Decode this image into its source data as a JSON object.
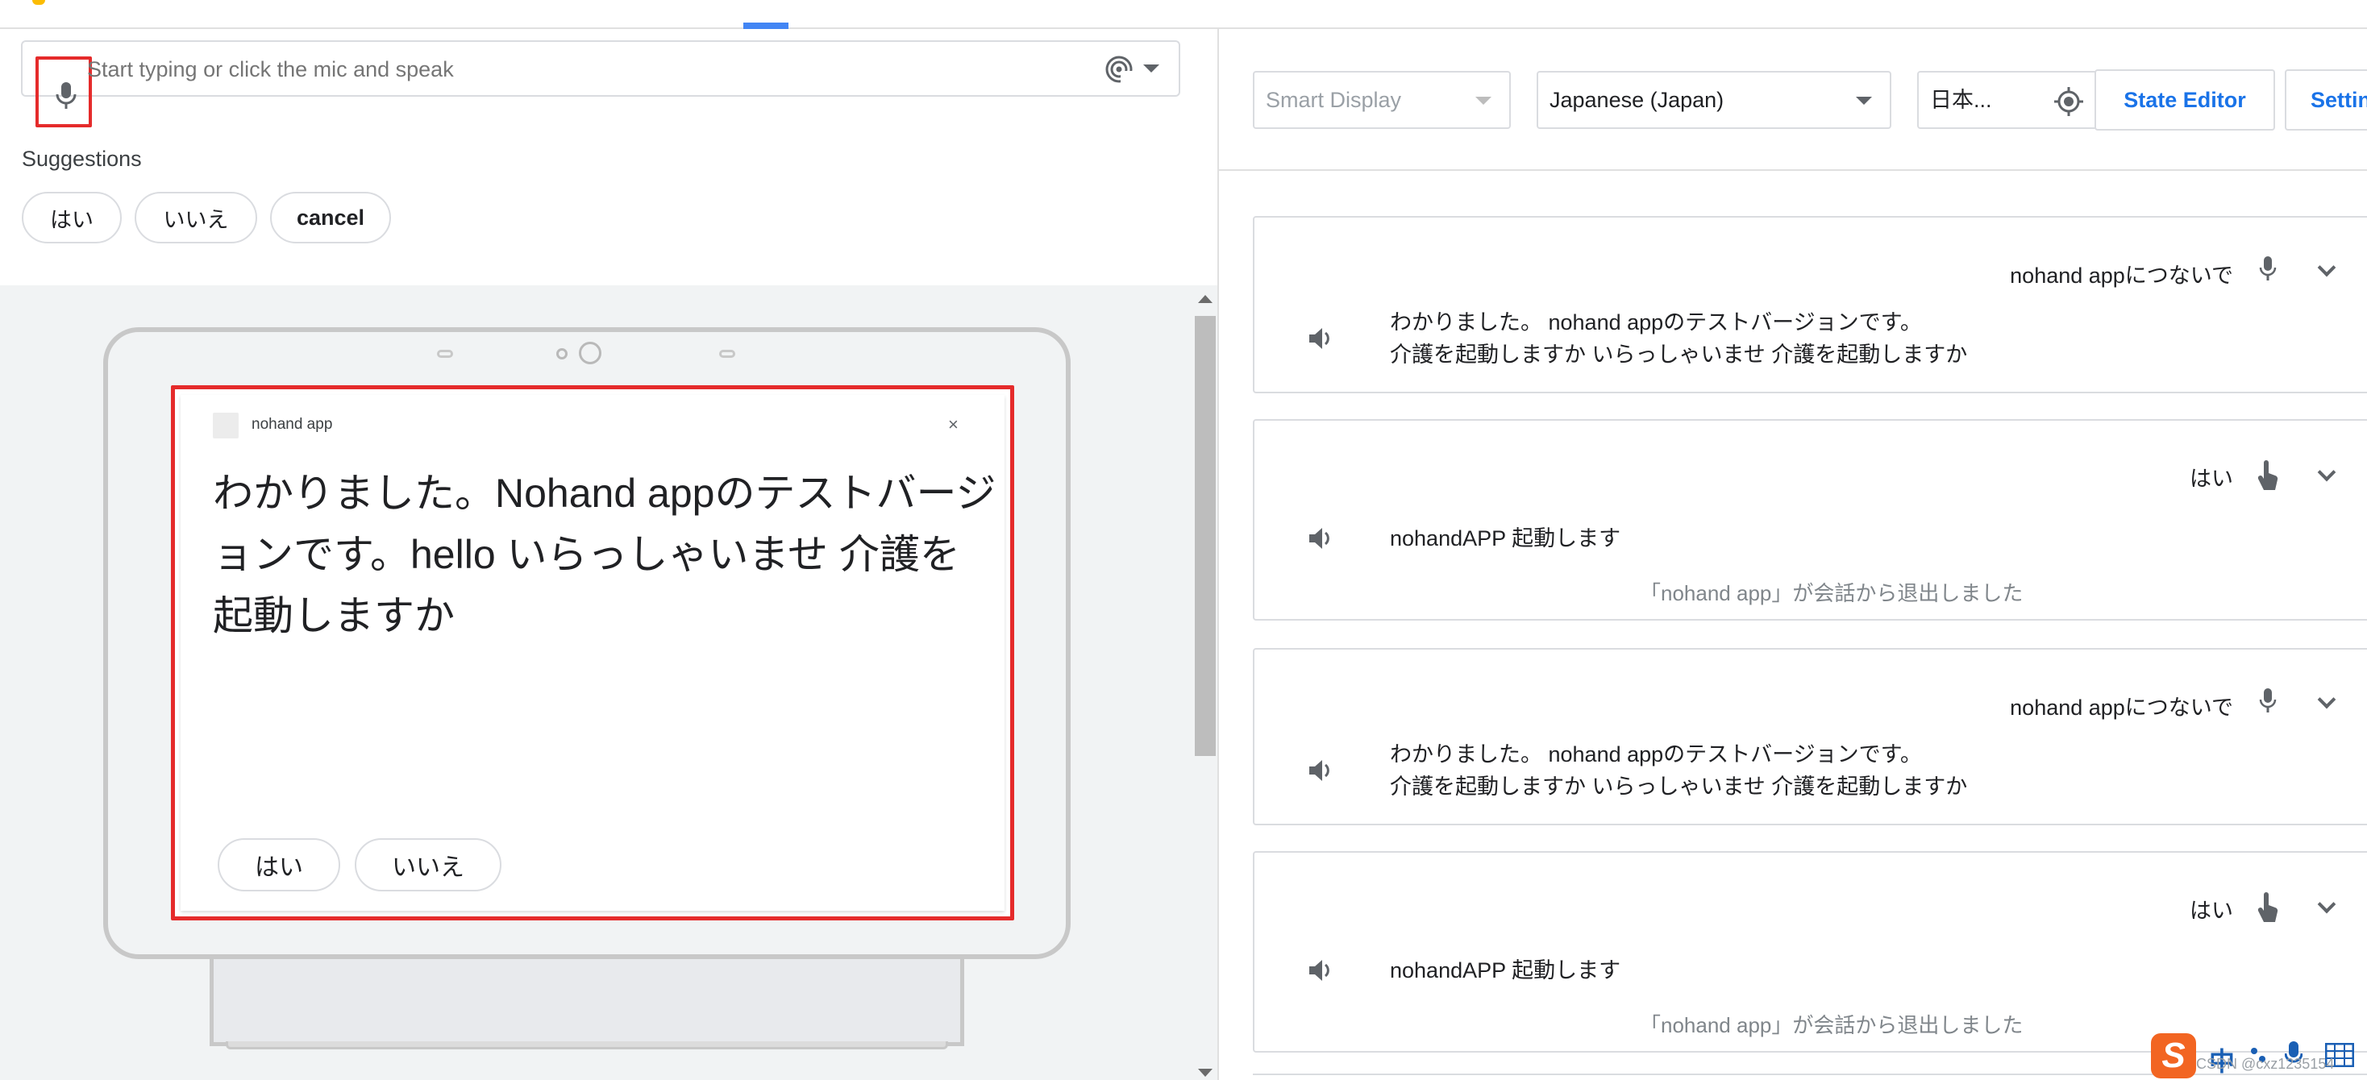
{
  "left_panel": {
    "input": {
      "placeholder": "Start typing or click the mic and speak"
    },
    "suggestions_label": "Suggestions",
    "suggestion_chips": [
      "はい",
      "いいえ",
      "cancel"
    ],
    "device_screen": {
      "app_name": "nohand app",
      "close_glyph": "×",
      "response_text": "わかりました。Nohand appのテストバージョンです。hello いらっしゃいませ 介護を起動しますか",
      "chips": [
        "はい",
        "いいえ"
      ]
    }
  },
  "right_panel": {
    "toolbar": {
      "device_select": "Smart Display",
      "language_select": "Japanese (Japan)",
      "location_select": "日本...",
      "state_editor_button": "State Editor",
      "settings_button": "Settin"
    },
    "conversation": [
      {
        "user_input": "nohand appにつないで",
        "input_type": "mic",
        "reply_line1": "わかりました。 nohand appのテストバージョンです。",
        "reply_line2": "介護を起動しますか いらっしゃいませ 介護を起動しますか"
      },
      {
        "user_input": "はい",
        "input_type": "touch",
        "reply_line1": "nohandAPP 起動します",
        "exit_notice": "「nohand app」が会話から退出しました"
      },
      {
        "user_input": "nohand appにつないで",
        "input_type": "mic",
        "reply_line1": "わかりました。 nohand appのテストバージョンです。",
        "reply_line2": "介護を起動しますか いらっしゃいませ 介護を起動しますか"
      },
      {
        "user_input": "はい",
        "input_type": "touch",
        "reply_line1": "nohandAPP 起動します",
        "exit_notice": "「nohand app」が会話から退出しました"
      }
    ]
  },
  "ime_toolbar": {
    "logo": "S",
    "mode": "中",
    "watermark": "CSDN @cxz1235154"
  },
  "colors": {
    "accent_blue": "#1a73e8",
    "highlight_red": "#e52b2b",
    "border_gray": "#dadce0",
    "ime_orange": "#f26522"
  },
  "icons": [
    "mic-icon",
    "voice-match-icon",
    "location-target-icon",
    "speaker-icon",
    "touch-hand-icon",
    "chevron-down-icon"
  ]
}
